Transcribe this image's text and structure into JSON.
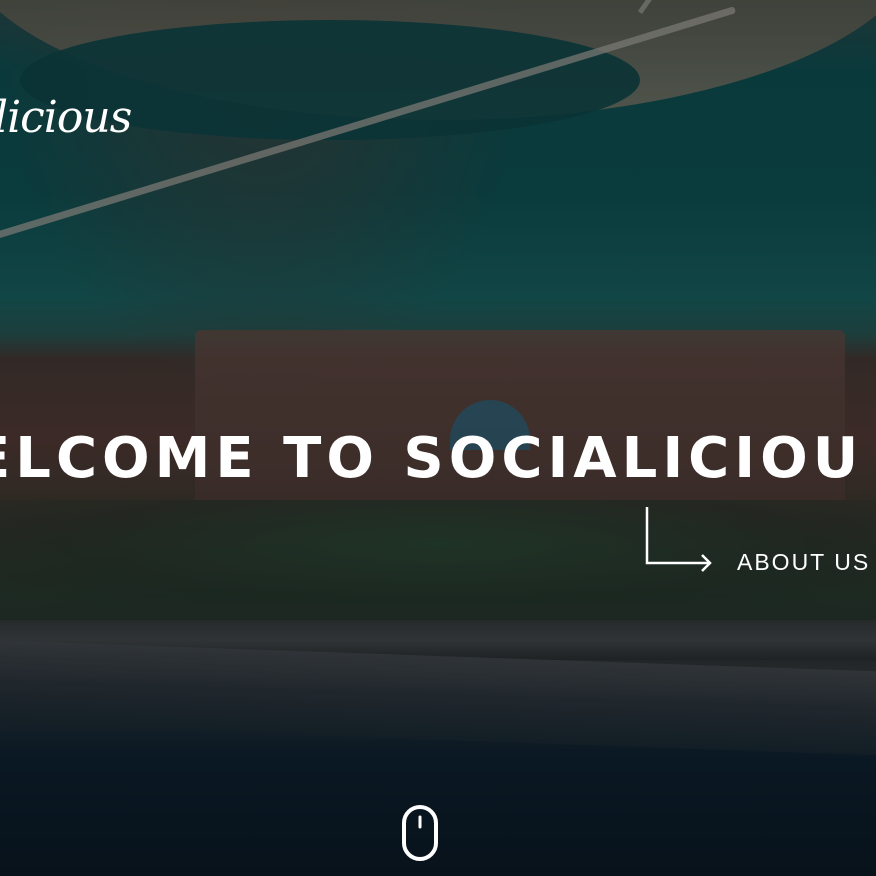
{
  "brand": {
    "logo_text": "licious"
  },
  "hero": {
    "headline": "ELCOME TO SOCIALICIOU",
    "about_link_label": "ABOUT US"
  },
  "icons": {
    "about_arrow": "arrow-down-right-icon",
    "scroll": "mouse-scroll-icon"
  },
  "colors": {
    "text": "#ffffff",
    "water": "#0f5656",
    "overlay": "#030a0e"
  }
}
